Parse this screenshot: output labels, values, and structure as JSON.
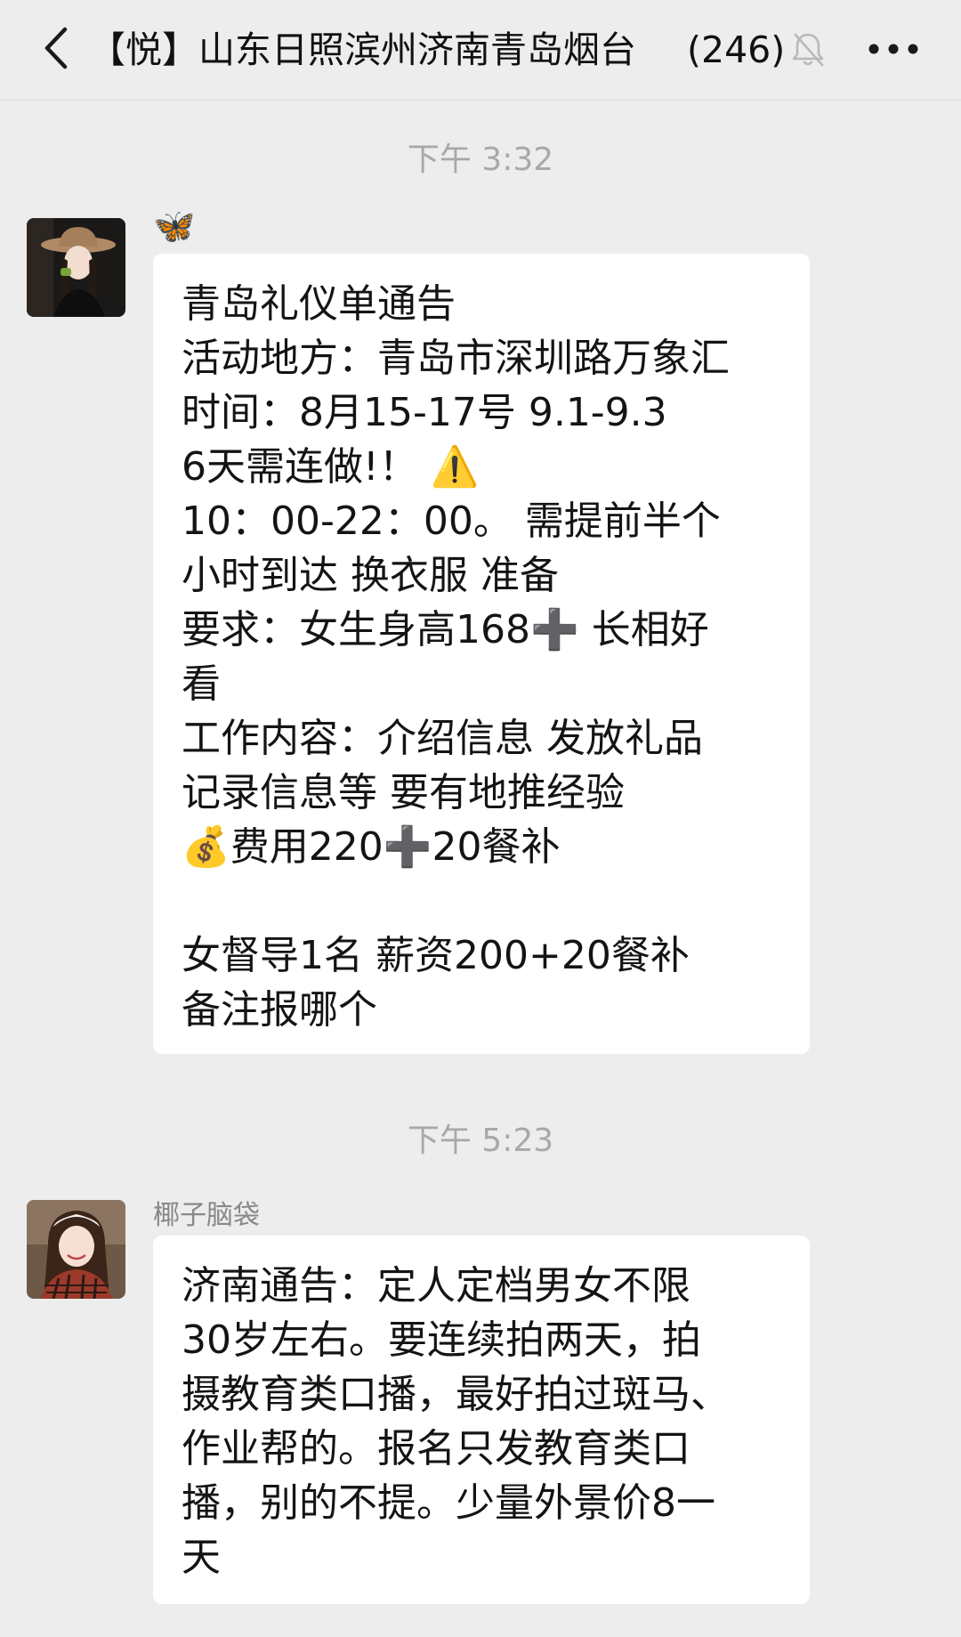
{
  "header": {
    "title": "【悦】山东日照滨州济南青岛烟台",
    "member_count": "(246)",
    "back_icon": "chevron-left-icon",
    "mute_icon": "bell-slash-icon",
    "more_icon": "more-dots-icon"
  },
  "messages": [
    {
      "time": "下午 3:32",
      "sender": "🦋",
      "lines": [
        "青岛礼仪单通告",
        "活动地方：青岛市深圳路万象汇",
        "时间：8月15-17号 9.1-9.3",
        "6天需连做!！ ⚠️",
        "10：00-22：00。 需提前半个",
        "小时到达 换衣服 准备",
        "要求：女生身高168➕ 长相好",
        "看",
        "工作内容：介绍信息 发放礼品",
        "记录信息等 要有地推经验",
        "💰费用220➕20餐补",
        "",
        "女督导1名 薪资200+20餐补",
        "备注报哪个"
      ]
    },
    {
      "time": "下午 5:23",
      "sender": "椰子脑袋",
      "lines": [
        "济南通告：定人定档男女不限",
        "30岁左右。要连续拍两天，拍",
        "摄教育类口播，最好拍过斑马、",
        "作业帮的。报名只发教育类口",
        "播，别的不提。少量外景价8一",
        "天"
      ]
    }
  ]
}
